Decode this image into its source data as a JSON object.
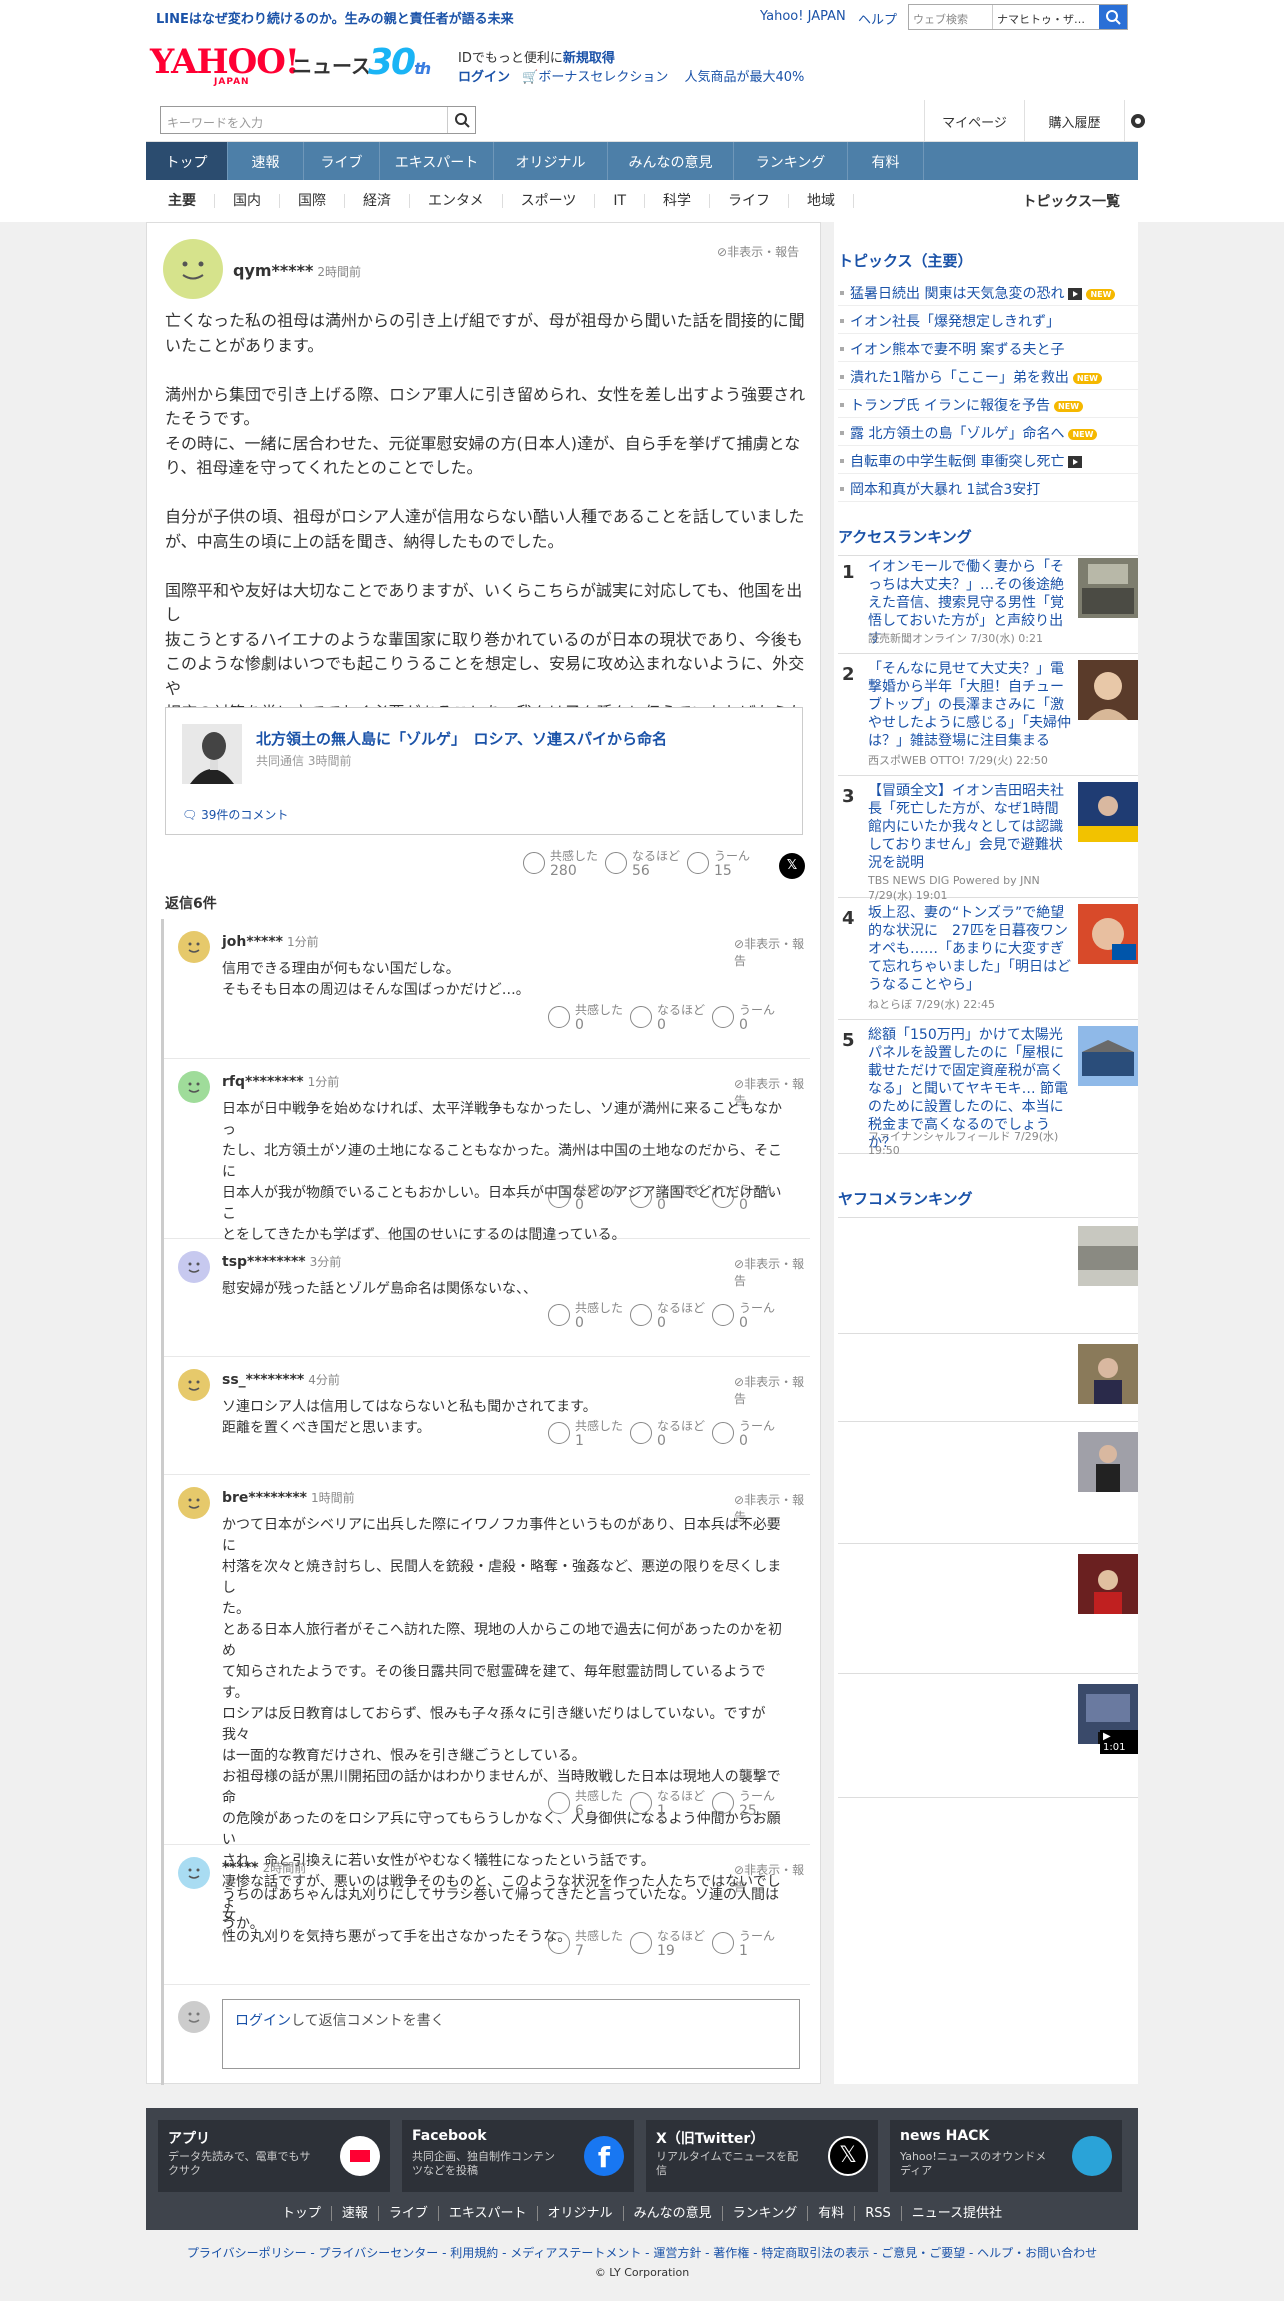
{
  "topbar": {
    "promo": "LINEはなぜ変わり続けるのか。生みの親と責任者が語る未来",
    "yahoo_japan": "Yahoo! JAPAN",
    "help": "ヘルプ",
    "search_placeholder": "ウェブ検索",
    "search_value": "ナマヒトゥ・ザ…"
  },
  "header": {
    "logo_main": "YAHOO!",
    "logo_sub": "JAPAN",
    "news": "ニュース",
    "anniversary": "30",
    "anniversary_suffix": "th",
    "id_text_pre": "IDでもっと便利に",
    "id_text_link": "新規取得",
    "login": "ログイン",
    "bonus": "ボーナスセレクション",
    "popular": "人気商品が最大40%"
  },
  "searchbar": {
    "placeholder": "キーワードを入力",
    "mypage": "マイページ",
    "history": "購入履歴"
  },
  "nav": [
    "トップ",
    "速報",
    "ライブ",
    "エキスパート",
    "オリジナル",
    "みんなの意見",
    "ランキング",
    "有料"
  ],
  "subnav": [
    "主要",
    "国内",
    "国際",
    "経済",
    "エンタメ",
    "スポーツ",
    "IT",
    "科学",
    "ライフ",
    "地域"
  ],
  "subnav_right": "トピックス一覧",
  "comment": {
    "user": "qym*****",
    "time": "2時間前",
    "report": "非表示・報告",
    "body": "亡くなった私の祖母は満州からの引き上げ組ですが、母が祖母から聞いた話を間接的に聞\nいたことがあります。\n\n満州から集団で引き上げる際、ロシア軍人に引き留められ、女性を差し出すよう強要され\nたそうです。\nその時に、一緒に居合わせた、元従軍慰安婦の方(日本人)達が、自ら手を挙げて捕虜とな\nり、祖母達を守ってくれたとのことでした。\n\n自分が子供の頃、祖母がロシア人達が信用ならない酷い人種であることを話していました\nが、中高生の頃に上の話を聞き、納得したものでした。\n\n国際平和や友好は大切なことでありますが、いくらこちらが誠実に対応しても、他国を出し\n抜こうとするハイエナのような輩国家に取り巻かれているのが日本の現状であり、今後も\nこのような惨劇はいつでも起こりうることを想定し、安易に攻め込まれないように、外交や\n相応の対策を常に立てておく必要があることを、我々は子々孫々に伝えていかねばならな\nいと思います。",
    "article_title": "北方領土の無人島に「ゾルゲ」　ロシア、ソ連スパイから命名",
    "article_source": "共同通信",
    "article_time": "3時間前",
    "article_comments": "39件のコメント",
    "reactions": [
      {
        "label": "共感した",
        "count": "280"
      },
      {
        "label": "なるほど",
        "count": "56"
      },
      {
        "label": "うーん",
        "count": "15"
      }
    ],
    "replies_count": "返信6件"
  },
  "replies": [
    {
      "user": "joh*****",
      "time": "1分前",
      "body": "信用できる理由が何もない国だしな。\nそもそも日本の周辺はそんな国ばっかだけど…。",
      "r": [
        "0",
        "0",
        "0"
      ],
      "color": "#e6c96b"
    },
    {
      "user": "rfq********",
      "time": "1分前",
      "body": "日本が日中戦争を始めなければ、太平洋戦争もなかったし、ソ連が満州に来ることもなかっ\nたし、北方領土がソ連の土地になることもなかった。満州は中国の土地なのだから、そこに\n日本人が我が物顔でいることもおかしい。日本兵が中国などのアジア諸国でどれだけ酷いこ\nとをしてきたかも学ばず、他国のせいにするのは間違っている。",
      "r": [
        "0",
        "0",
        "0"
      ],
      "color": "#9fdc9a"
    },
    {
      "user": "tsp********",
      "time": "3分前",
      "body": "慰安婦が残った話とゾルゲ島命名は関係ないな、、",
      "r": [
        "0",
        "0",
        "0"
      ],
      "color": "#c7c9ef"
    },
    {
      "user": "ss_********",
      "time": "4分前",
      "body": "ソ連ロシア人は信用してはならないと私も聞かされてます。\n距離を置くべき国だと思います。",
      "r": [
        "1",
        "0",
        "0"
      ],
      "color": "#e6c96b"
    },
    {
      "user": "bre********",
      "time": "1時間前",
      "body": "かつて日本がシベリアに出兵した際にイワノフカ事件というものがあり、日本兵は不必要に\n村落を次々と焼き討ちし、民間人を銃殺・虐殺・略奪・強姦など、悪逆の限りを尽くしまし\nた。\nとある日本人旅行者がそこへ訪れた際、現地の人からこの地で過去に何があったのかを初め\nて知らされたようです。その後日露共同で慰霊碑を建て、毎年慰霊訪問しているようです。\nロシアは反日教育はしておらず、恨みも子々孫々に引き継いだりはしていない。ですが我々\nは一面的な教育だけされ、恨みを引き継ごうとしている。\nお祖母様の話が黒川開拓団の話かはわかりませんが、当時敗戦した日本は現地人の襲撃で命\nの危険があったのをロシア兵に守ってもらうしかなく、人身御供になるよう仲間からお願い\nされ、命と引換えに若い女性がやむなく犠牲になったという話です。\n凄惨な話ですが、悪いのは戦争そのものと、このような状況を作った人たちではないでしょ\nうか。",
      "r": [
        "6",
        "1",
        "25"
      ],
      "color": "#e6c96b"
    },
    {
      "user": "*****",
      "time": "2時間前",
      "body": "うちのばあちゃんは丸刈りにしてサラシ巻いて帰ってきたと言っていたな。ソ連の人間は女\n性の丸刈りを気持ち悪がって手を出さなかったそうな。",
      "r": [
        "7",
        "19",
        "1"
      ],
      "color": "#a9dcf2"
    }
  ],
  "reaction_labels": [
    "共感した",
    "なるほど",
    "うーん"
  ],
  "reply_login_link": "ログイン",
  "reply_login_rest": "して返信コメントを書く",
  "side": {
    "topics_title": "トピックス（主要）",
    "topics": [
      {
        "t": "猛暑日続出 関東は天気急変の恐れ",
        "v": true,
        "n": true
      },
      {
        "t": "イオン社長「爆発想定しきれず」"
      },
      {
        "t": "イオン熊本で妻不明 案ずる夫と子"
      },
      {
        "t": "潰れた1階から「ここー」弟を救出",
        "n": true
      },
      {
        "t": "トランプ氏 イランに報復を予告",
        "n": true
      },
      {
        "t": "露 北方領土の島「ゾルゲ」命名へ",
        "n": true
      },
      {
        "t": "自転車の中学生転倒 車衝突し死亡",
        "v": true
      },
      {
        "t": "岡本和真が大暴れ 1試合3安打"
      }
    ],
    "new_label": "NEW",
    "access_title": "アクセスランキング",
    "access": [
      {
        "n": "1",
        "t": "イオンモールで働く妻から「そっちは大丈夫？」…その後途絶えた音信、捜索見守る男性「覚悟しておいた方が」と声絞り出す",
        "s": "読売新聞オンライン 7/30(水) 0:21"
      },
      {
        "n": "2",
        "t": "「そんなに見せて大丈夫？」電撃婚から半年「大胆！自チューブトップ」の長澤まさみに「激やせしたように感じる」「夫婦仲は？」雑誌登場に注目集まる",
        "s": "西スポWEB OTTO! 7/29(火) 22:50"
      },
      {
        "n": "3",
        "t": "【冒頭全文】イオン吉田昭夫社長「死亡した方が、なぜ1時間館内にいたか我々としては認識しておりません」会見で避難状況を説明",
        "s": "TBS NEWS DIG Powered by JNN 7/29(水) 19:01"
      },
      {
        "n": "4",
        "t": "坂上忍、妻の“トンズラ”で絶望的な状況に　27匹を日暮夜ワンオペも……「あまりに大変すぎて忘れちゃいました」「明日はどうなることやら」",
        "s": "ねとらぼ 7/29(水) 22:45"
      },
      {
        "n": "5",
        "t": "総額「150万円」かけて太陽光パネルを設置したのに「屋根に載せただけで固定資産税が高くなる」と聞いてヤキモキ… 節電のために設置したのに、本当に税金まで高くなるのでしょうか？",
        "s": "ファイナンシャルフィールド 7/29(水) 19:50"
      }
    ],
    "yafukome_title": "ヤフコメランキング",
    "video_time": "1:01"
  },
  "footer": {
    "cards": [
      {
        "t": "アプリ",
        "d": "データ先読みで、電車でもサクサク"
      },
      {
        "t": "Facebook",
        "d": "共同企画、独自制作コンテンツなどを投稿"
      },
      {
        "t": "X（旧Twitter）",
        "d": "リアルタイムでニュースを配信"
      },
      {
        "t": "news HACK",
        "d": "Yahoo!ニュースのオウンドメディア"
      }
    ],
    "links": [
      "トップ",
      "速報",
      "ライブ",
      "エキスパート",
      "オリジナル",
      "みんなの意見",
      "ランキング",
      "有料",
      "RSS",
      "ニュース提供社"
    ],
    "bottom": "プライバシーポリシー - プライバシーセンター - 利用規約 - メディアステートメント - 運営方針 - 著作権 - 特定商取引法の表示 - ご意見・ご要望 - ヘルプ・お問い合わせ",
    "copyright": "© LY Corporation"
  }
}
